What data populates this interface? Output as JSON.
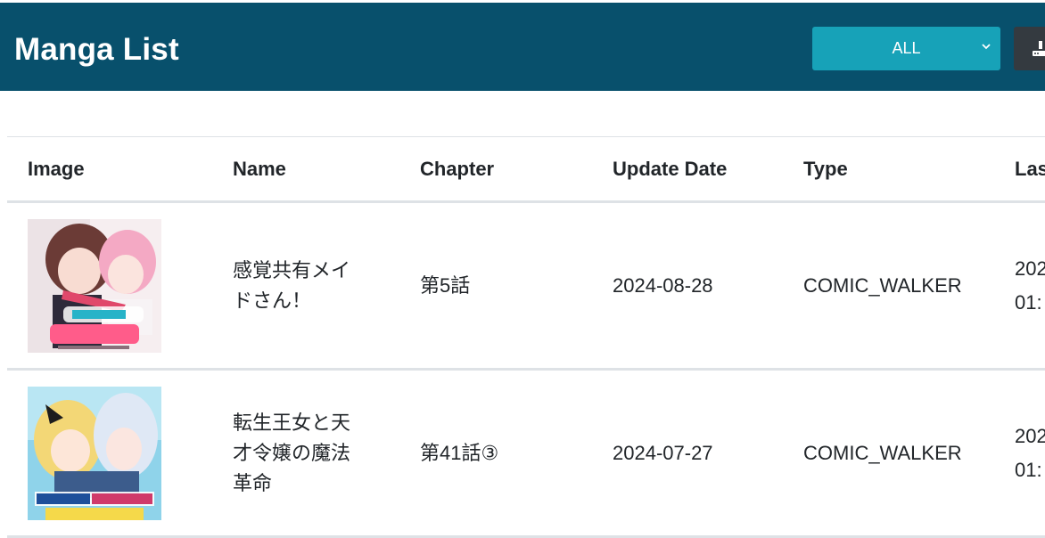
{
  "header": {
    "title": "Manga List",
    "filter": {
      "selected": "ALL"
    },
    "colors": {
      "bar": "#08506c",
      "filter": "#17a2b8",
      "dark_button": "#343a40"
    }
  },
  "table": {
    "columns": [
      "Image",
      "Name",
      "Chapter",
      "Update Date",
      "Type",
      "Las"
    ],
    "rows": [
      {
        "image": "manga-cover-kankaku-kyouyuu-maid-san",
        "name": "感覚共有メイドさん！",
        "chapter": "第5話",
        "update_date": "2024-08-28",
        "type": "COMIC_WALKER",
        "last_line1": "202",
        "last_line2": "01:"
      },
      {
        "image": "manga-cover-tensei-oujo-to-tensai-reijou",
        "name": "転生王女と天才令嬢の魔法革命",
        "chapter": "第41話③",
        "update_date": "2024-07-27",
        "type": "COMIC_WALKER",
        "last_line1": "202",
        "last_line2": "01:"
      }
    ]
  }
}
